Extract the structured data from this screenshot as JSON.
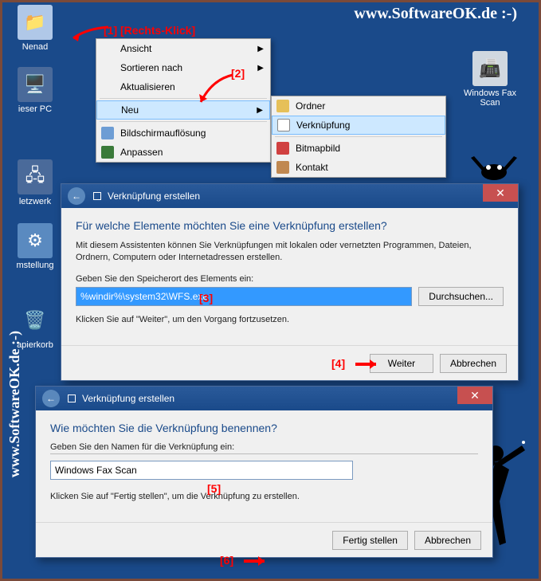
{
  "watermark": {
    "top": "www.SoftwareOK.de :-)",
    "left": "www.SoftwareOK.de :-)"
  },
  "desktop": {
    "nenad": "Nenad",
    "pc": "ieser PC",
    "net": "letzwerk",
    "ctrl": "mstellung",
    "bin": "apierkorb",
    "fax": "Windows Fax Scan"
  },
  "ctx1": {
    "ansicht": "Ansicht",
    "sortieren": "Sortieren nach",
    "aktualisieren": "Aktualisieren",
    "neu": "Neu",
    "aufloesung": "Bildschirmauflösung",
    "anpassen": "Anpassen"
  },
  "ctx2": {
    "ordner": "Ordner",
    "verkn": "Verknüpfung",
    "bitmap": "Bitmapbild",
    "kontakt": "Kontakt"
  },
  "anno": {
    "a1": "[1]  [Rechts-Klick]",
    "a2": "[2]",
    "a3": "[3]",
    "a4": "[4]",
    "a5": "[5]",
    "a6": "[6]"
  },
  "dlg1": {
    "title": "Verknüpfung erstellen",
    "heading": "Für welche Elemente möchten Sie eine Verknüpfung erstellen?",
    "desc": "Mit diesem Assistenten können Sie Verknüpfungen mit lokalen oder vernetzten Programmen, Dateien, Ordnern, Computern oder Internetadressen erstellen.",
    "label": "Geben Sie den Speicherort des Elements ein:",
    "value": "%windir%\\system32\\WFS.exe",
    "browse": "Durchsuchen...",
    "hint": "Klicken Sie auf \"Weiter\", um den Vorgang fortzusetzen.",
    "next": "Weiter",
    "cancel": "Abbrechen"
  },
  "dlg2": {
    "title": "Verknüpfung erstellen",
    "heading": "Wie möchten Sie die Verknüpfung benennen?",
    "label": "Geben Sie den Namen für die Verknüpfung ein:",
    "value": "Windows Fax Scan",
    "hint": "Klicken Sie auf \"Fertig stellen\", um die Verknüpfung zu erstellen.",
    "finish": "Fertig stellen",
    "cancel": "Abbrechen"
  }
}
